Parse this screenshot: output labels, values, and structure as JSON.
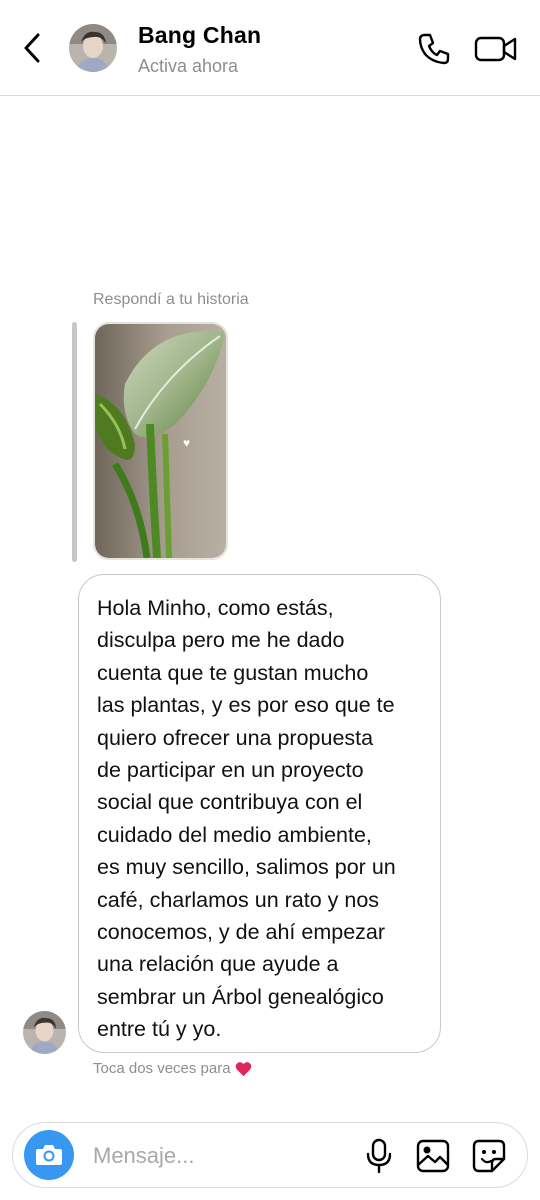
{
  "header": {
    "contact_name": "Bang Chan",
    "status": "Activa ahora",
    "icons": [
      "chevron-left-icon",
      "avatar",
      "phone-icon",
      "video-camera-icon"
    ]
  },
  "conversation": {
    "story_reply_label": "Respondí a tu historia",
    "message_text": "Hola Minho, como estás,\ndisculpa pero me he dado\ncuenta que te gustan mucho\nlas plantas, y es por eso que te\nquiero ofrecer una propuesta\nde participar en un proyecto\nsocial que contribuya con el\ncuidado del medio ambiente,\nes muy sencillo, salimos por un\ncafé, charlamos un rato y nos\nconocemos, y de ahí empezar\nuna relación que ayude a\nsembrar un Árbol genealógico\nentre tú y yo.",
    "double_tap_hint": "Toca dos veces para",
    "double_tap_emoji": "❤️"
  },
  "composer": {
    "placeholder": "Mensaje...",
    "icons": [
      "camera-icon",
      "microphone-icon",
      "gallery-icon",
      "sticker-icon"
    ]
  },
  "colors": {
    "camera_button": "#3897f0",
    "secondary_text": "#8e8e8e",
    "heart": "#e0245e"
  }
}
